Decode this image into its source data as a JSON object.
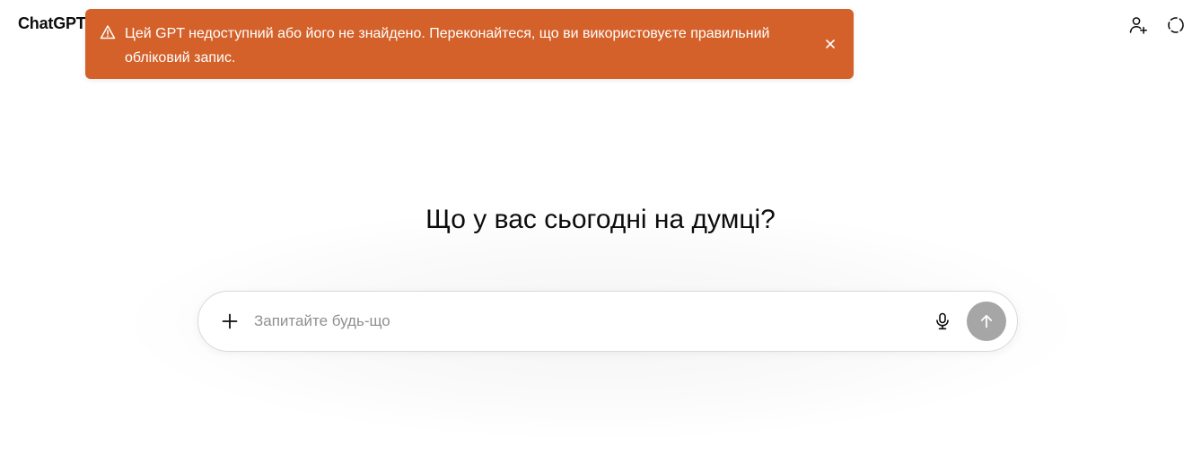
{
  "app": {
    "title": "ChatGPT"
  },
  "toast": {
    "message": "Цей GPT недоступний або його не знайдено. Переконайтеся, що ви використовуєте правильний обліковий запис.",
    "icon": "warning-triangle-icon",
    "close_icon": "close-icon",
    "background": "#d4612a"
  },
  "header": {
    "actions": [
      {
        "name": "add-user",
        "icon": "add-user-icon"
      },
      {
        "name": "temporary-chat",
        "icon": "dashed-circle-icon"
      }
    ]
  },
  "main": {
    "headline": "Що у вас сьогодні на думці?",
    "composer": {
      "placeholder": "Запитайте будь-що",
      "value": "",
      "plus_icon": "plus-icon",
      "mic_icon": "microphone-icon",
      "send_icon": "arrow-up-icon",
      "send_color": "#a6a6a6"
    }
  }
}
